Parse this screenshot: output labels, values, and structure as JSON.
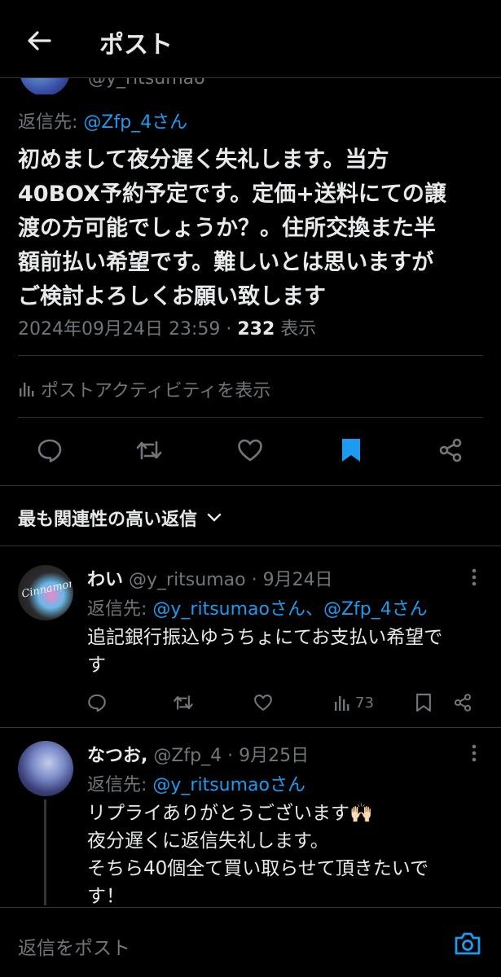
{
  "header": {
    "title": "ポスト"
  },
  "main_post": {
    "partial_handle": "@y_ritsumao",
    "reply_to_label": "返信先: ",
    "reply_to_mention": "@Zfp_4さん",
    "text": "初めまして夜分遅く失礼します。当方\n40BOX予約予定です。定価+送料にての譲\n渡の方可能でしょうか？。住所交換また半\n額前払い希望です。難しいとは思いますが\nご検討よろしくお願い致します",
    "timestamp": "2024年09月24日 23:59 · ",
    "views_count": "232",
    "views_label": " 表示",
    "activity_label": "ポストアクティビティを表示",
    "actions": {
      "reply_icon": "reply-icon",
      "repost_icon": "repost-icon",
      "like_icon": "like-icon",
      "bookmark_icon": "bookmark-icon",
      "bookmark_active_color": "#1d9bf0",
      "share_icon": "share-icon"
    }
  },
  "sort": {
    "label": "最も関連性の高い返信"
  },
  "replies": [
    {
      "name": "わい",
      "handle": " @y_ritsumao · 9月24日",
      "reply_to_label": "返信先: ",
      "reply_to_mention": "@y_ritsumaoさん、@Zfp_4さん",
      "avatar_text": "Cinnamon",
      "text": "追記銀行振込ゆうちょにてお支払い希望で\nす",
      "views": "73"
    },
    {
      "name": "なつお,",
      "handle": " @Zfp_4 · 9月25日",
      "reply_to_label": "返信先: ",
      "reply_to_mention": "@y_ritsumaoさん",
      "text": "リプライありがとうございます🙌🏻\n夜分遅くに返信失礼します。\nそちら40個全て買い取らせて頂きたいで\nす！"
    }
  ],
  "compose": {
    "placeholder": "返信をポスト"
  },
  "colors": {
    "background": "#000000",
    "text": "#e7e9ea",
    "secondary": "#71767b",
    "accent": "#1d9bf0",
    "divider": "#2f3336"
  }
}
